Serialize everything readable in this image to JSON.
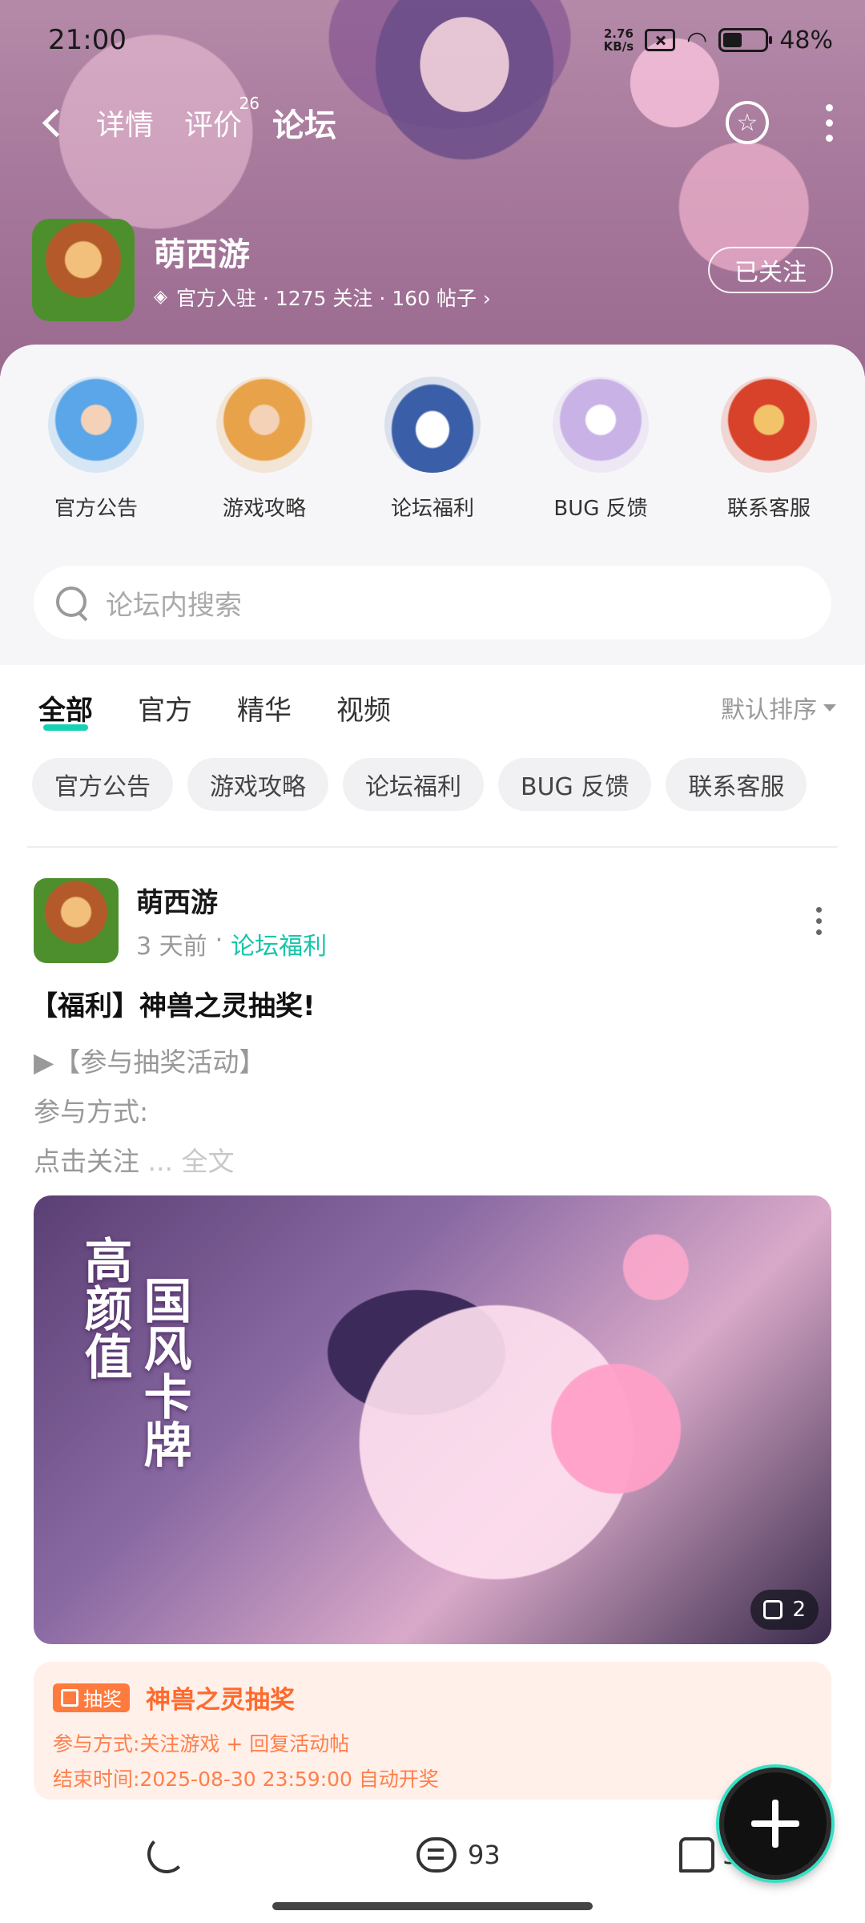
{
  "status": {
    "time": "21:00",
    "speed_top": "2.76",
    "speed_bottom": "KB/s",
    "battery": "48%"
  },
  "nav": {
    "tabs": [
      {
        "label": "详情"
      },
      {
        "label": "评价",
        "badge": "26"
      },
      {
        "label": "论坛"
      }
    ]
  },
  "game": {
    "name": "萌西游",
    "meta": "官方入驻 · 1275 关注 · 160 帖子 ›",
    "follow_label": "已关注"
  },
  "categories": [
    {
      "label": "官方公告",
      "color": "#5aa6e8"
    },
    {
      "label": "游戏攻略",
      "color": "#e8a24a"
    },
    {
      "label": "论坛福利",
      "color": "#3a5fa8"
    },
    {
      "label": "BUG 反馈",
      "color": "#c9b3e6"
    },
    {
      "label": "联系客服",
      "color": "#d8412a"
    }
  ],
  "search": {
    "placeholder": "论坛内搜索"
  },
  "filters": {
    "tabs": [
      {
        "label": "全部"
      },
      {
        "label": "官方"
      },
      {
        "label": "精华"
      },
      {
        "label": "视频"
      }
    ],
    "sort_label": "默认排序"
  },
  "chips": [
    "官方公告",
    "游戏攻略",
    "论坛福利",
    "BUG 反馈",
    "联系客服"
  ],
  "post": {
    "author": "萌西游",
    "time": "3 天前",
    "separator": "·",
    "category": "论坛福利",
    "title": "【福利】神兽之灵抽奖!",
    "line1": "▶【参与抽奖活动】",
    "line2": "参与方式:",
    "line3": "点击关注",
    "more": " ... 全文",
    "image_text1": "高颜值",
    "image_text2": "国风卡牌",
    "image_count": "2",
    "lottery": {
      "badge": "抽奖",
      "title": "神兽之灵抽奖",
      "line1": "参与方式:关注游戏 + 回复活动帖",
      "line2": "结束时间:2025-08-30 23:59:00 自动开奖"
    },
    "comments": "93",
    "likes": "5"
  }
}
